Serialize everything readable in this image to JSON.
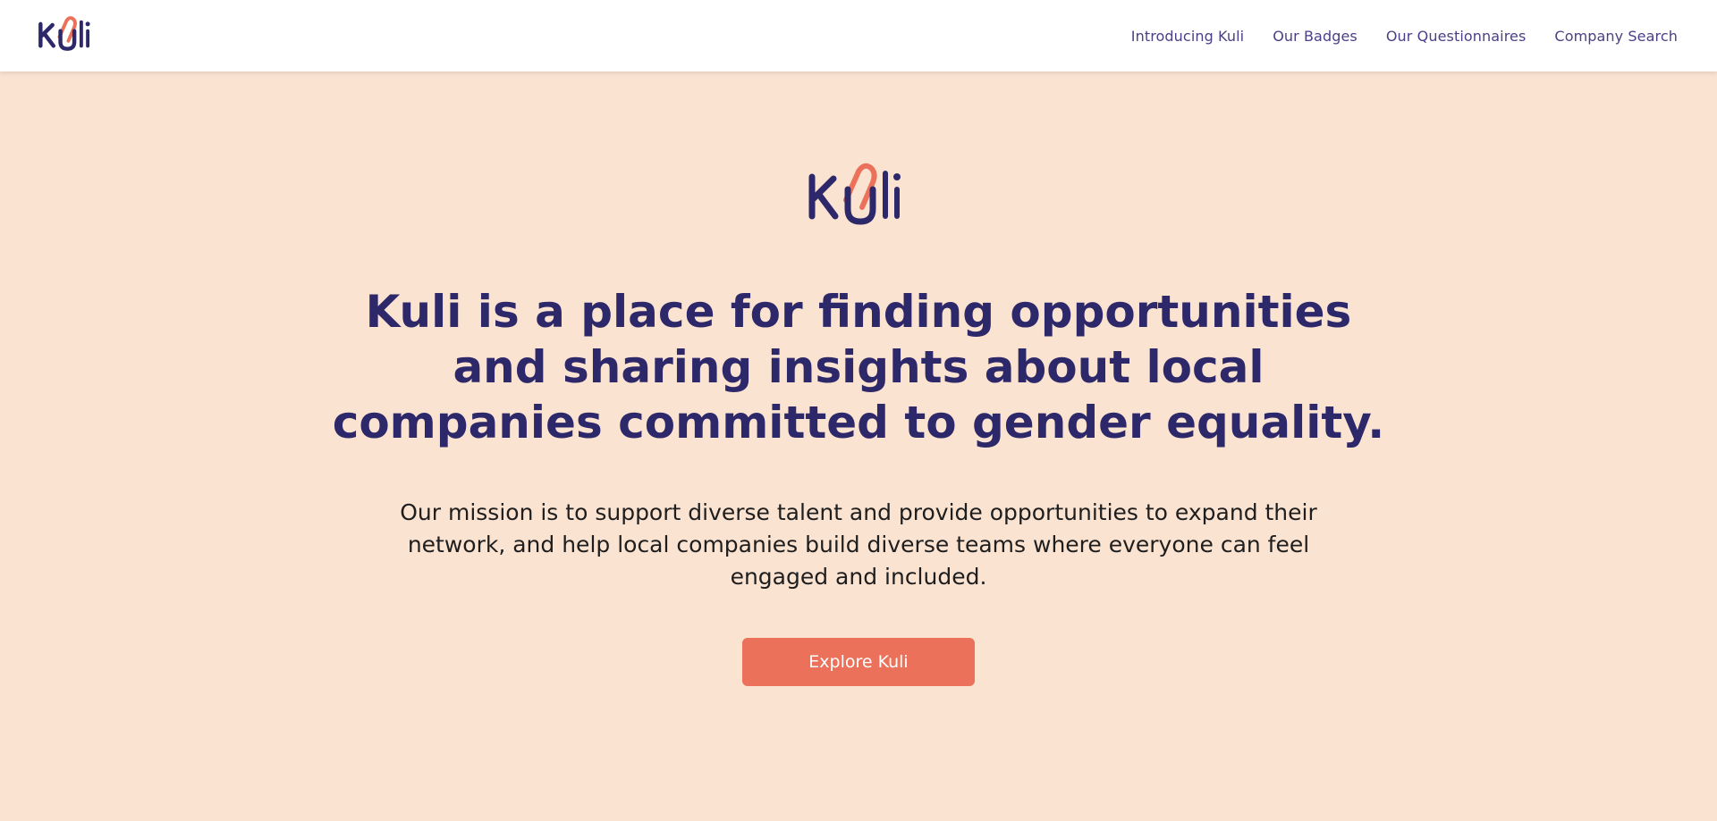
{
  "brand": {
    "name": "Kuli",
    "colors": {
      "primary": "#2d2869",
      "accent": "#eb715a",
      "background": "#fbe3d2",
      "nav_text": "#4b3f86"
    }
  },
  "nav": {
    "items": [
      {
        "label": "Introducing Kuli"
      },
      {
        "label": "Our Badges"
      },
      {
        "label": "Our Questionnaires"
      },
      {
        "label": "Company Search"
      }
    ]
  },
  "hero": {
    "headline": "Kuli is a place for finding opportunities and sharing insights about local companies committed to gender equality.",
    "mission": "Our mission is to support diverse talent and provide opportunities to expand their network, and help local companies build diverse teams where everyone can feel engaged and included.",
    "cta_label": "Explore Kuli"
  }
}
